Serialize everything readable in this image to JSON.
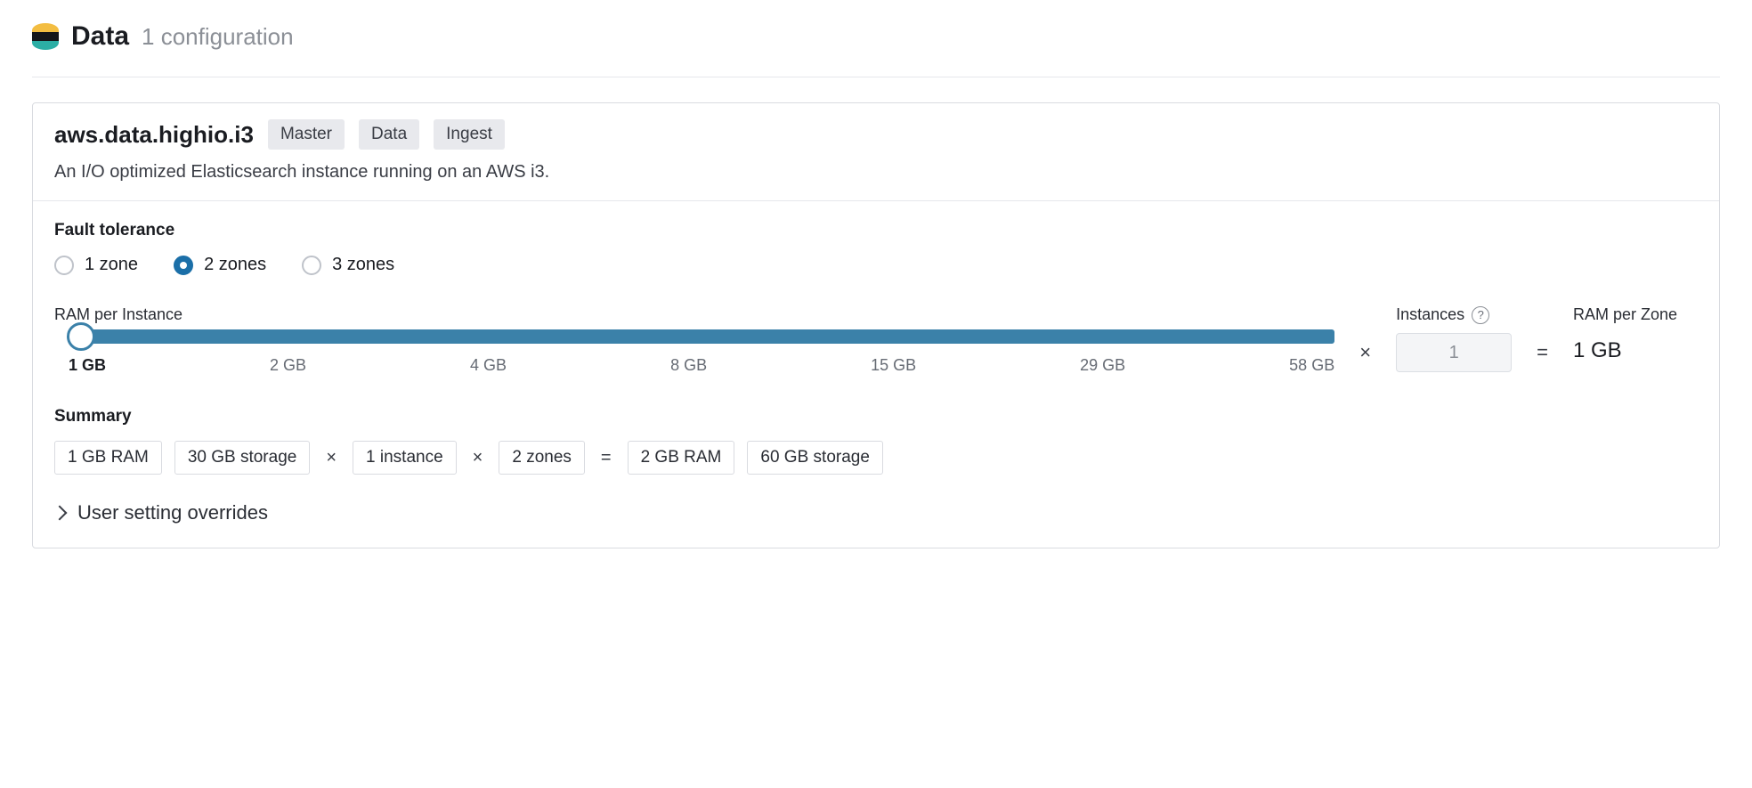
{
  "header": {
    "title": "Data",
    "subtitle": "1 configuration"
  },
  "instance": {
    "name": "aws.data.highio.i3",
    "badges": [
      "Master",
      "Data",
      "Ingest"
    ],
    "description": "An I/O optimized Elasticsearch instance running on an AWS i3."
  },
  "fault_tolerance": {
    "label": "Fault tolerance",
    "options": [
      {
        "label": "1 zone",
        "selected": false
      },
      {
        "label": "2 zones",
        "selected": true
      },
      {
        "label": "3 zones",
        "selected": false
      }
    ]
  },
  "ram_slider": {
    "label": "RAM per Instance",
    "ticks": [
      "1 GB",
      "2 GB",
      "4 GB",
      "8 GB",
      "15 GB",
      "29 GB",
      "58 GB"
    ],
    "selected_index": 0
  },
  "instances": {
    "label": "Instances",
    "value": "1"
  },
  "ram_per_zone": {
    "label": "RAM per Zone",
    "value": "1 GB"
  },
  "operators": {
    "times": "×",
    "equals": "="
  },
  "summary": {
    "label": "Summary",
    "parts": {
      "ram": "1 GB RAM",
      "storage": "30 GB storage",
      "instances": "1 instance",
      "zones": "2 zones",
      "total_ram": "2 GB RAM",
      "total_storage": "60 GB storage"
    }
  },
  "overrides": {
    "label": "User setting overrides"
  }
}
